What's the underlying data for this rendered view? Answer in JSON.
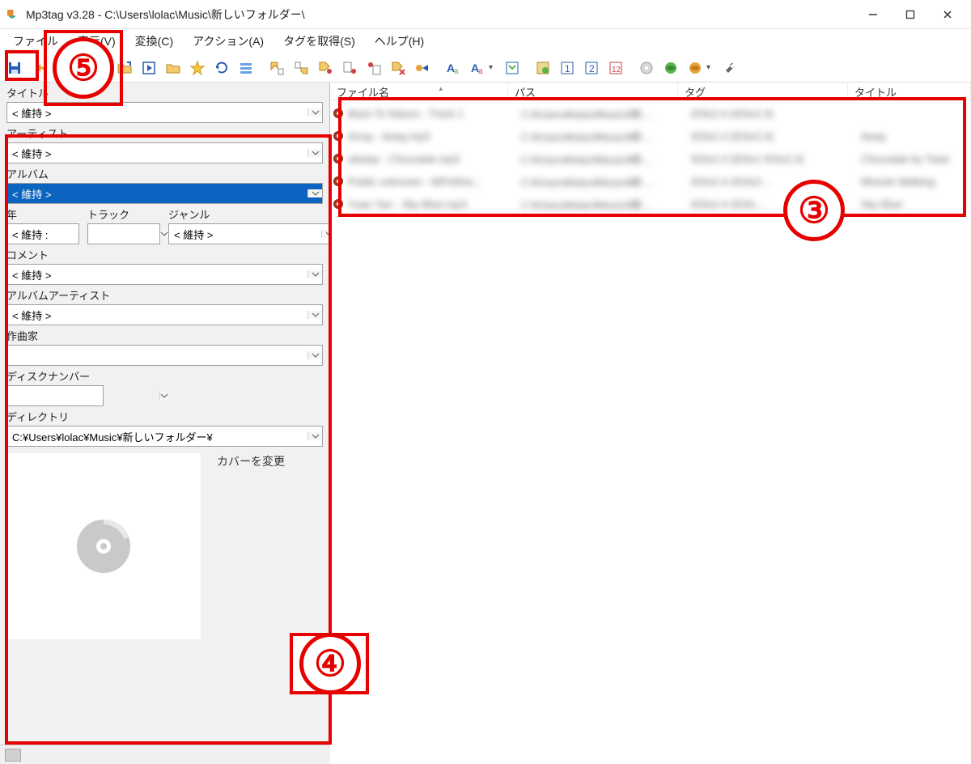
{
  "window": {
    "title": "Mp3tag v3.28  -  C:\\Users\\lolac\\Music\\新しいフォルダー\\"
  },
  "menu": {
    "file": "ファイル",
    "view": "表示(V)",
    "convert": "変換(C)",
    "action": "アクション(A)",
    "tagSources": "タグを取得(S)",
    "help": "ヘルプ(H)"
  },
  "toolbar": {
    "save": "save",
    "undo": "undo"
  },
  "panel": {
    "title_label": "タイトル",
    "title_value": "< 維持 >",
    "artist_label": "アーティスト",
    "artist_value": "< 維持 >",
    "album_label": "アルバム",
    "album_value": "< 維持 >",
    "year_label": "年",
    "year_value": "< 維持 :",
    "track_label": "トラック",
    "track_value": "",
    "genre_label": "ジャンル",
    "genre_value": "< 維持 >",
    "comment_label": "コメント",
    "comment_value": "< 維持 >",
    "albumartist_label": "アルバムアーティスト",
    "albumartist_value": "< 維持 >",
    "composer_label": "作曲家",
    "composer_value": "",
    "discnum_label": "ディスクナンバー",
    "discnum_value": "",
    "directory_label": "ディレクトリ",
    "directory_value": "C:¥Users¥lolac¥Music¥新しいフォルダー¥",
    "cover_change": "カバーを変更"
  },
  "columns": {
    "filename": "ファイル名",
    "path": "パス",
    "tag": "タグ",
    "title": "タイトル"
  },
  "annotations": {
    "n3": "③",
    "n4": "④",
    "n5": "⑤"
  },
  "rows": [
    {
      "file": "Back To Nature - Track 1",
      "path": "C:¥Users¥lolac¥Music¥新…",
      "tag": "ID3v2.4 (ID3v2.4)",
      "title": ""
    },
    {
      "file": "Array - Away.mp3",
      "path": "C:¥Users¥lolac¥Music¥新…",
      "tag": "ID3v2.4 (ID3v2.4)",
      "title": "Away"
    },
    {
      "file": "ubstep - Chocolate.mp3",
      "path": "C:¥Users¥lolac¥Music¥新…",
      "tag": "ID3v2.4 (ID3v1 ID3v2.4)",
      "title": "Chocolate by Twist"
    },
    {
      "file": "Public unknown - MPrefine...",
      "path": "C:¥Users¥lolac¥Music¥新…",
      "tag": "ID3v2.4 (ID3v2…",
      "title": "Miracle Walking"
    },
    {
      "file": "Yuan Yan - Sky Blue.mp3",
      "path": "C:¥Users¥lolac¥Music¥新…",
      "tag": "ID3v2.4 (ID3v…",
      "title": "Sky Blue"
    }
  ]
}
